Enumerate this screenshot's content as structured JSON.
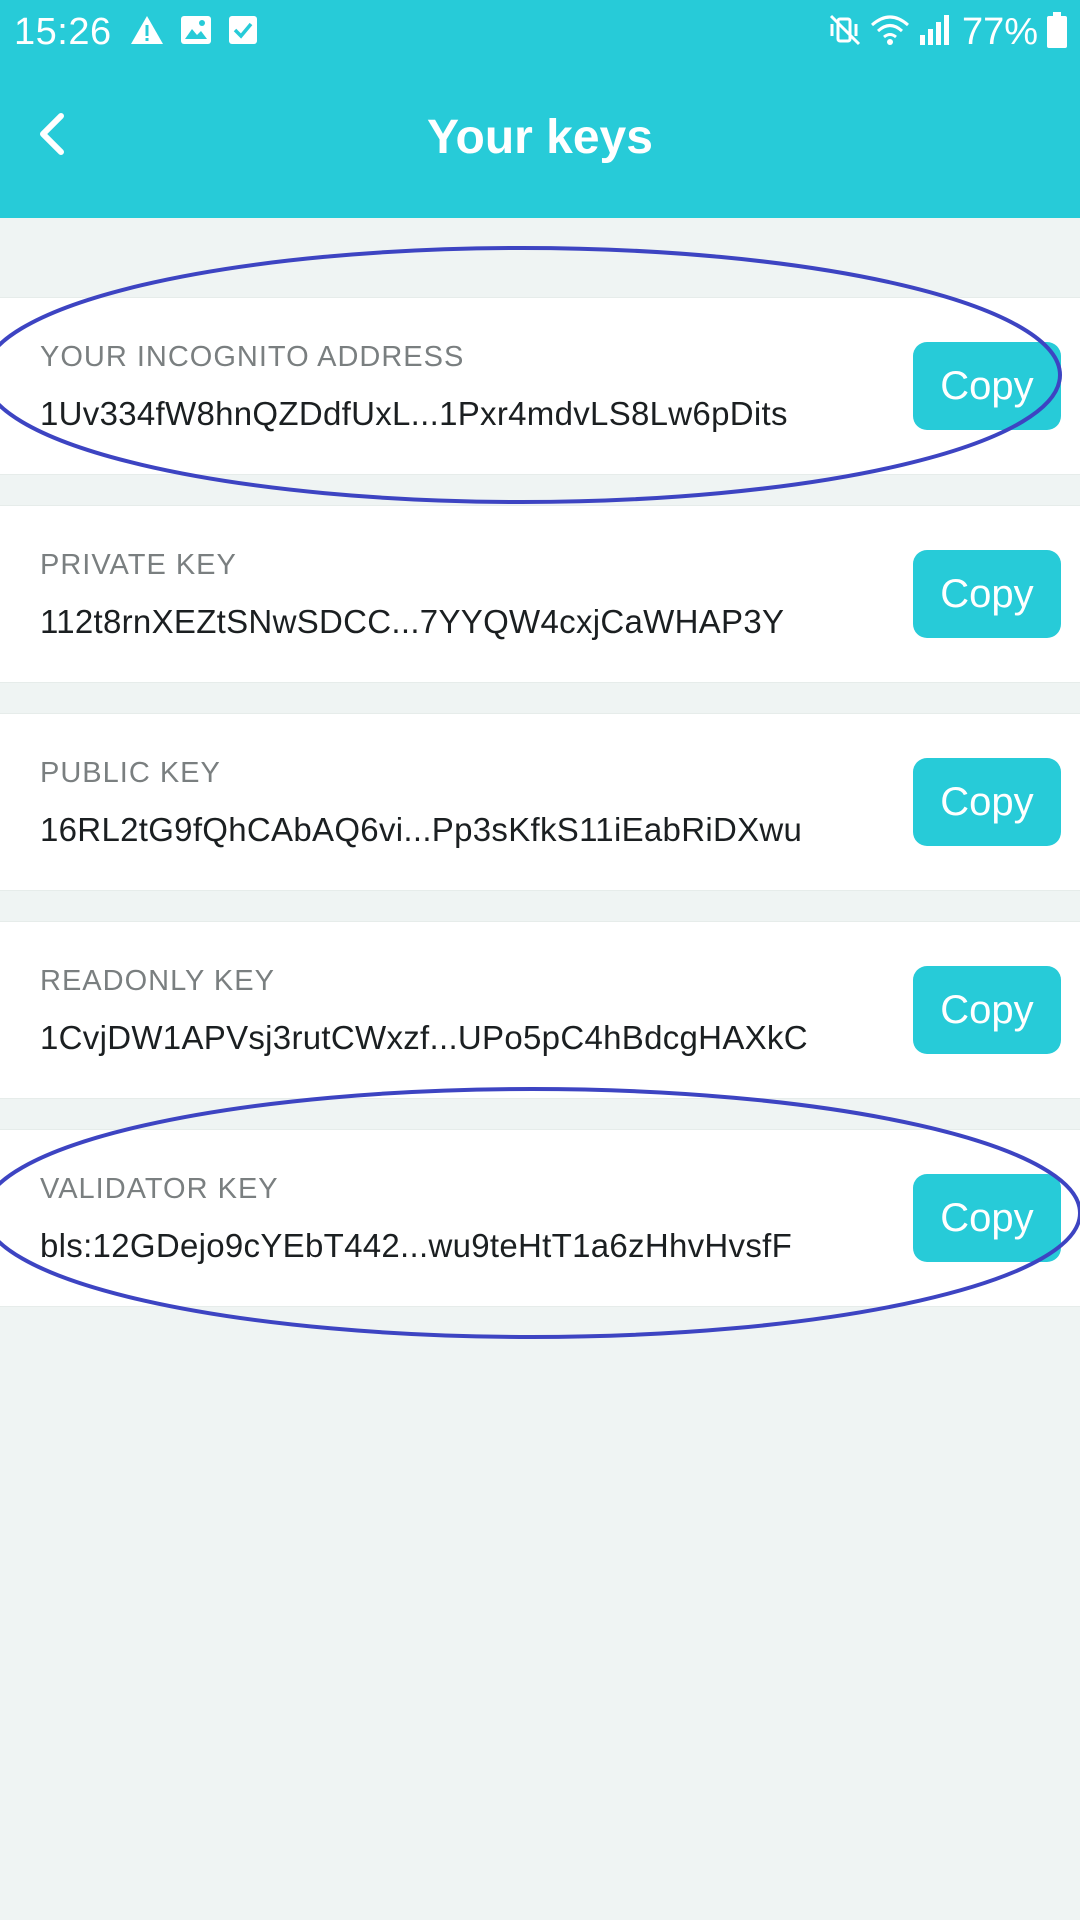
{
  "status_bar": {
    "time": "15:26",
    "left_icons": [
      "warning-icon",
      "image-icon",
      "checkbox-icon"
    ],
    "right_icons": [
      "vibrate-mute-icon",
      "wifi-icon",
      "signal-icon",
      "battery-icon"
    ],
    "battery": "77%"
  },
  "app_bar": {
    "title": "Your keys",
    "back_icon": "chevron-left-icon"
  },
  "keys": [
    {
      "label": "YOUR INCOGNITO ADDRESS",
      "value": "1Uv334fW8hnQZDdfUxL...1Pxr4mdvLS8Lw6pDits",
      "button": "Copy"
    },
    {
      "label": "PRIVATE KEY",
      "value": "112t8rnXEZtSNwSDCC...7YYQW4cxjCaWHAP3Y",
      "button": "Copy"
    },
    {
      "label": "PUBLIC KEY",
      "value": "16RL2tG9fQhCAbAQ6vi...Pp3sKfkS11iEabRiDXwu",
      "button": "Copy"
    },
    {
      "label": "READONLY KEY",
      "value": "1CvjDW1APVsj3rutCWxzf...UPo5pC4hBdcgHAXkC",
      "button": "Copy"
    },
    {
      "label": "VALIDATOR KEY",
      "value": "bls:12GDejo9cYEbT442...wu9teHtT1a6zHhvHvsfF",
      "button": "Copy"
    }
  ],
  "colors": {
    "accent": "#27cbd8",
    "background": "#eff4f3",
    "annotation": "#3d44c2"
  }
}
